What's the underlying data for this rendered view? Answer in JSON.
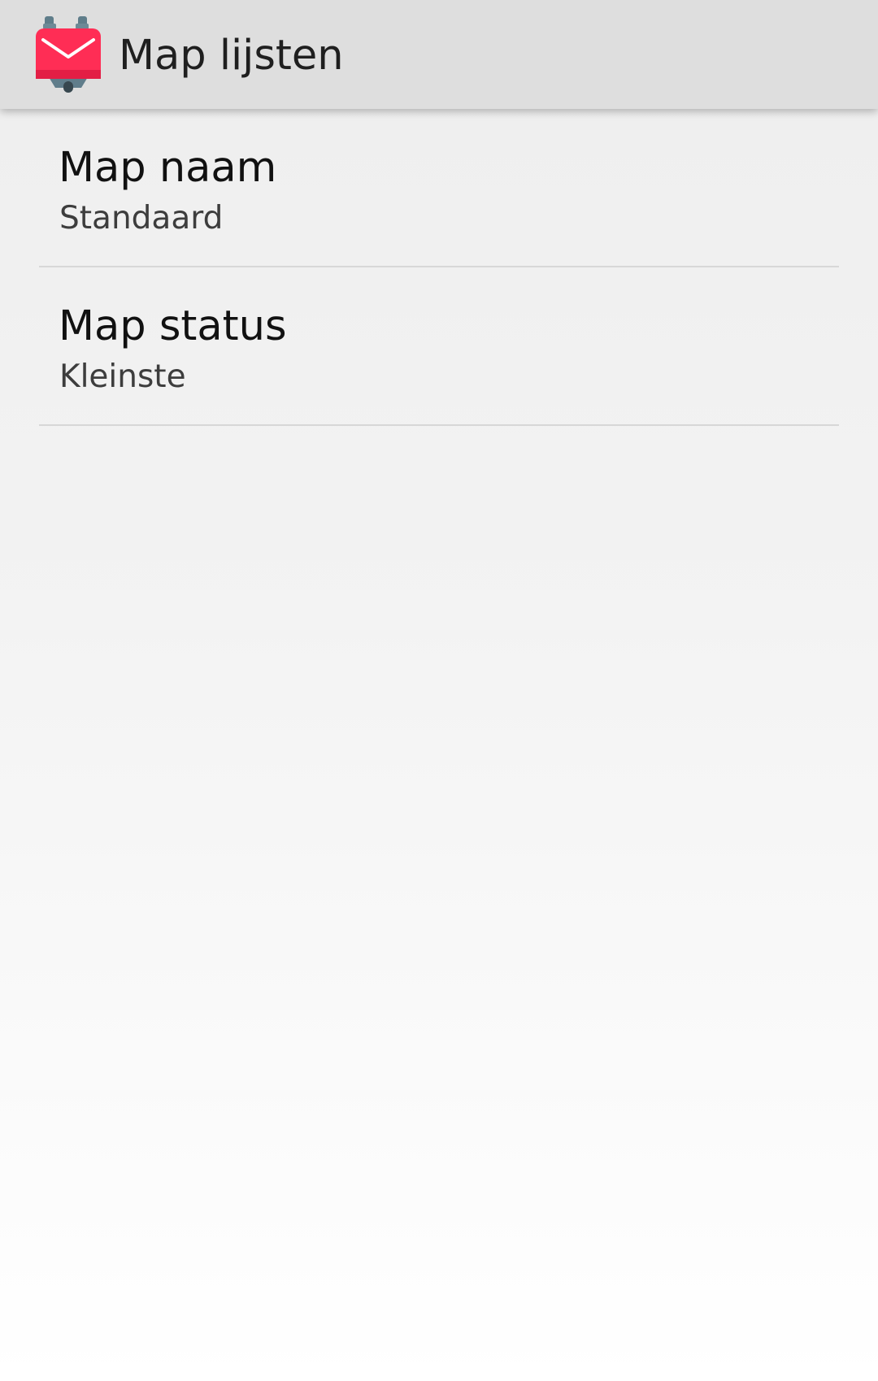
{
  "app_bar": {
    "title": "Map lijsten",
    "icon": "k9-mail-app-icon"
  },
  "preferences": [
    {
      "title": "Map naam",
      "summary": "Standaard"
    },
    {
      "title": "Map status",
      "summary": "Kleinste"
    }
  ],
  "colors": {
    "app_bar_background": "#dedede",
    "icon_red": "#ff2d55",
    "icon_gray": "#5f7d8a",
    "divider": "#d7d7d7"
  }
}
